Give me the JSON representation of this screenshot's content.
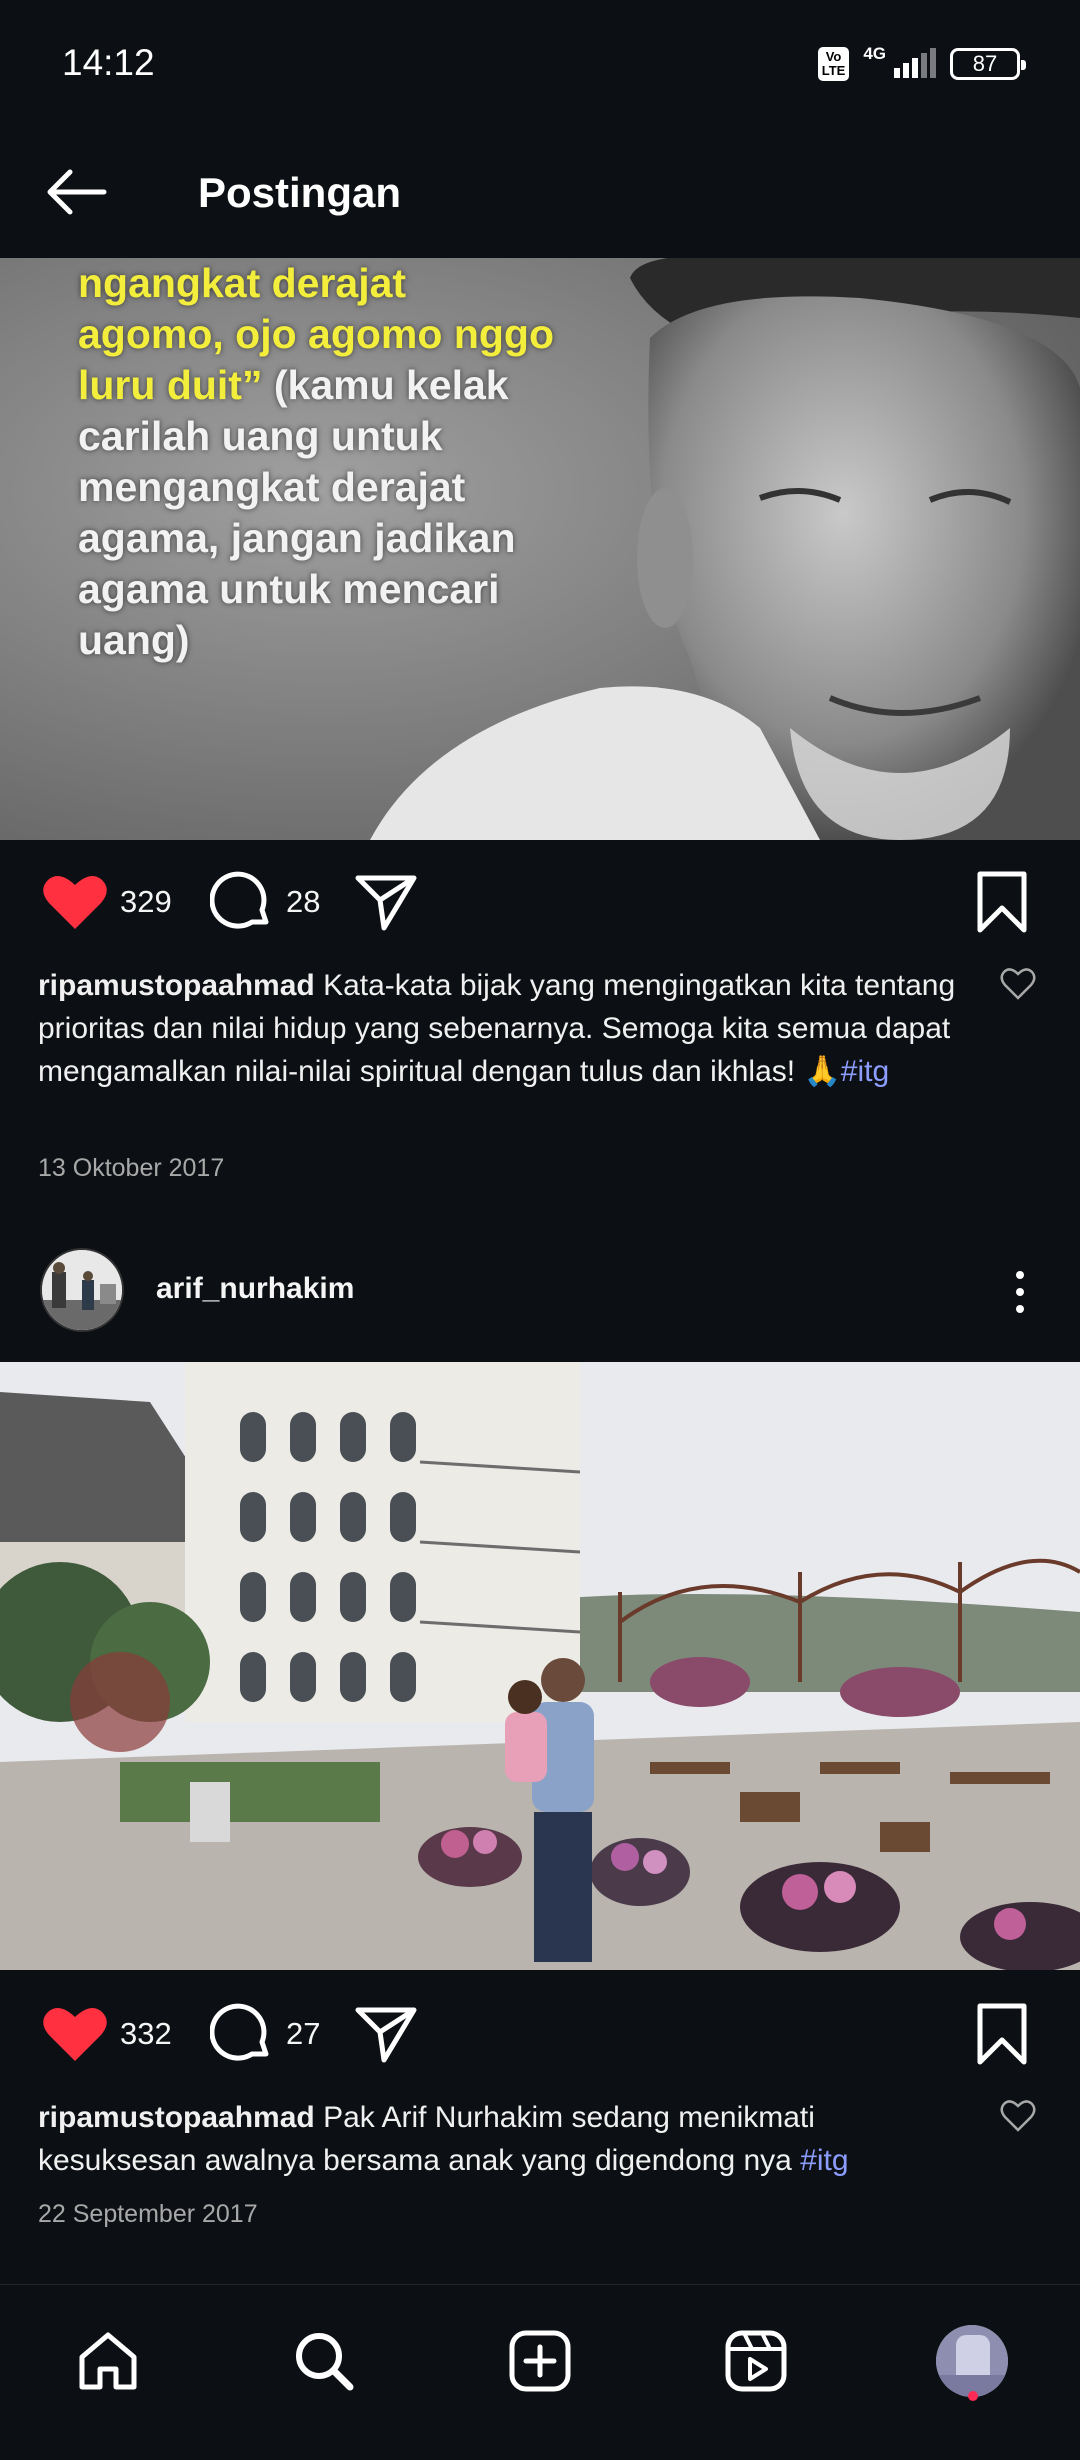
{
  "status_bar": {
    "time": "14:12",
    "volte": "Vo\nLTE",
    "network": "4G",
    "battery": "87"
  },
  "header": {
    "title": "Postingan",
    "back_icon": "arrow-left-icon"
  },
  "posts": [
    {
      "image_text": {
        "yellow": "ngangkat derajat\nagomo, ojo agomo nggo\nluru duit”",
        "white": " (kamu kelak\ncarilah uang untuk\nmengangkat derajat\nagama, jangan jadikan\nagama untuk mencari\nuang)"
      },
      "likes": "329",
      "comments": "28",
      "caption_user": "ripamustopaahmad",
      "caption_text": " Kata-kata bijak yang mengingatkan kita tentang prioritas dan nilai hidup yang sebenarnya. Semoga kita semua dapat mengamalkan nilai-nilai spiritual dengan tulus dan ikhlas! 🙏",
      "caption_tag": "#itg",
      "date": "13 Oktober 2017"
    },
    {
      "author": "arif_nurhakim",
      "likes": "332",
      "comments": "27",
      "caption_user": "ripamustopaahmad",
      "caption_text": " Pak Arif Nurhakim sedang menikmati kesuksesan awalnya bersama anak yang digendong nya ",
      "caption_tag": "#itg",
      "date": "22 September 2017"
    }
  ],
  "bottom_nav": {
    "items": [
      "home-icon",
      "search-icon",
      "create-icon",
      "reels-icon",
      "profile-avatar"
    ]
  },
  "colors": {
    "background": "#0c1014",
    "like_red": "#ff3040",
    "hashtag": "#8c9cff",
    "muted": "#a8a8a8"
  }
}
